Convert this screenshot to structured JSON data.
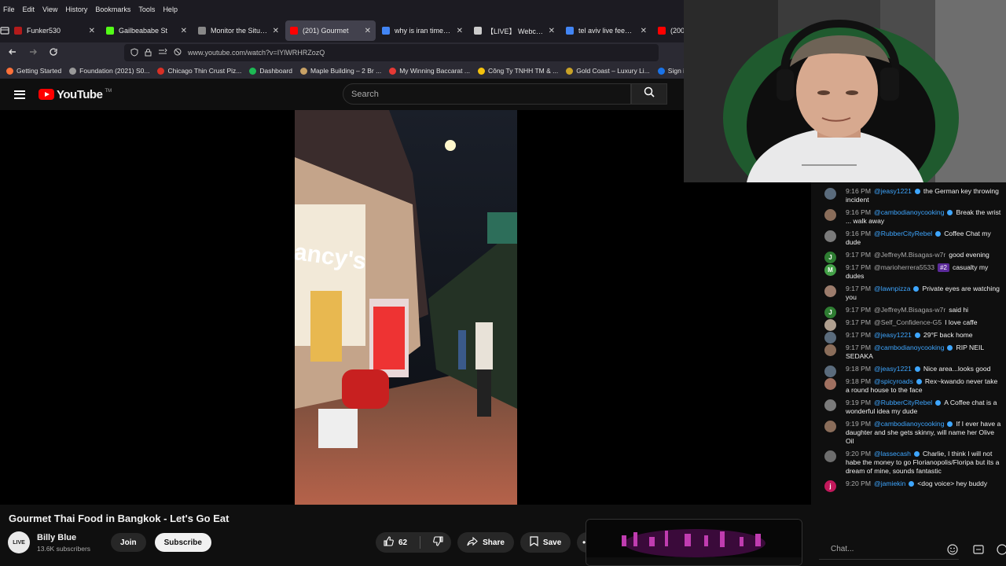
{
  "browser": {
    "menu": [
      "File",
      "Edit",
      "View",
      "History",
      "Bookmarks",
      "Tools",
      "Help"
    ],
    "tabs": [
      {
        "title": "Funker530",
        "color": "#b31b1b",
        "active": false
      },
      {
        "title": "Gailbeababe St",
        "color": "#53fc18",
        "active": false
      },
      {
        "title": "Monitor the Situatio",
        "color": "#888888",
        "active": false
      },
      {
        "title": "(201) Gourmet",
        "color": "#ff0000",
        "active": true
      },
      {
        "title": "why is iran time 30",
        "color": "#4285f4",
        "active": false
      },
      {
        "title": "【LIVE】 Webcam V",
        "color": "#cccccc",
        "active": false
      },
      {
        "title": "tel aviv live feed car",
        "color": "#4285f4",
        "active": false
      },
      {
        "title": "(200",
        "color": "#ff0000",
        "active": false
      }
    ],
    "url": "www.youtube.com/watch?v=IYlWRHRZozQ",
    "bookmarks": [
      {
        "label": "Getting Started",
        "color": "#ff7139"
      },
      {
        "label": "Foundation (2021) S0...",
        "color": "#999999"
      },
      {
        "label": "Chicago Thin Crust Piz...",
        "color": "#d93025"
      },
      {
        "label": "Dashboard",
        "color": "#1db954"
      },
      {
        "label": "Maple Building – 2 Br ...",
        "color": "#c8a165"
      },
      {
        "label": "My Winning Baccarat ...",
        "color": "#e53935"
      },
      {
        "label": "Công Ty TNHH TM & ...",
        "color": "#f4c20d"
      },
      {
        "label": "Gold Coast – Luxury Li...",
        "color": "#c9a227"
      },
      {
        "label": "Sign in - Dream",
        "color": "#1a73e8"
      }
    ]
  },
  "youtube": {
    "logo_text": "YouTube",
    "logo_tm": "TM",
    "search_placeholder": "Search",
    "video_title": "Gourmet Thai Food in Bangkok - Let's Go Eat",
    "channel": {
      "name": "Billy Blue",
      "subscribers": "13.6K subscribers",
      "avatar_text": "LIVE"
    },
    "join_label": "Join",
    "subscribe_label": "Subscribe",
    "like_count": "62",
    "share_label": "Share",
    "save_label": "Save",
    "video_sign_text": "ancy's"
  },
  "chat": {
    "placeholder": "Chat...",
    "messages": [
      {
        "time": "9:16 PM",
        "author": "@jeasy1221",
        "member": true,
        "text": "the German key throwing incident",
        "avatar_color": "#5a6b7c",
        "initial": ""
      },
      {
        "time": "9:16 PM",
        "author": "@cambodianoycooking",
        "member": true,
        "text": "Break the wrist ... walk away",
        "avatar_color": "#8a6d5a",
        "initial": ""
      },
      {
        "time": "9:16 PM",
        "author": "@RubberCityRebel",
        "member": true,
        "text": "Coffee Chat my dude",
        "avatar_color": "#7a7a7a",
        "initial": ""
      },
      {
        "time": "9:17 PM",
        "author": "@JeffreyM.Bisagas-w7r",
        "member": false,
        "text": "good evening",
        "avatar_color": "#2e7d32",
        "initial": "J"
      },
      {
        "time": "9:17 PM",
        "author": "@marioherrera5533",
        "member": false,
        "badge": "#2",
        "text": "casualty my dudes",
        "avatar_color": "#43a047",
        "initial": "M"
      },
      {
        "time": "9:17 PM",
        "author": "@lawnpizza",
        "member": true,
        "text": "Private eyes are watching you",
        "avatar_color": "#9c7c6c",
        "initial": ""
      },
      {
        "time": "9:17 PM",
        "author": "@JeffreyM.Bisagas-w7r",
        "member": false,
        "text": "said hi",
        "avatar_color": "#2e7d32",
        "initial": "J"
      },
      {
        "time": "9:17 PM",
        "author": "@Self_Confidence-G5",
        "member": false,
        "text": "I love caffe",
        "avatar_color": "#b0a090",
        "initial": ""
      },
      {
        "time": "9:17 PM",
        "author": "@jeasy1221",
        "member": true,
        "text": "29°F back home",
        "avatar_color": "#5a6b7c",
        "initial": ""
      },
      {
        "time": "9:17 PM",
        "author": "@cambodianoycooking",
        "member": true,
        "text": "RIP NEIL SEDAKA",
        "avatar_color": "#8a6d5a",
        "initial": ""
      },
      {
        "time": "9:18 PM",
        "author": "@jeasy1221",
        "member": true,
        "text": "Nice area...looks good",
        "avatar_color": "#5a6b7c",
        "initial": ""
      },
      {
        "time": "9:18 PM",
        "author": "@spicyroads",
        "member": true,
        "text": "Rex~kwando never take a round house to the face",
        "avatar_color": "#a07060",
        "initial": ""
      },
      {
        "time": "9:19 PM",
        "author": "@RubberCityRebel",
        "member": true,
        "text": "A Coffee chat is a wonderful idea my dude",
        "avatar_color": "#7a7a7a",
        "initial": ""
      },
      {
        "time": "9:19 PM",
        "author": "@cambodianoycooking",
        "member": true,
        "text": "If I ever have a daughter and she gets skinny, will name her Olive Oil",
        "avatar_color": "#8a6d5a",
        "initial": ""
      },
      {
        "time": "9:20 PM",
        "author": "@lassecash",
        "member": true,
        "text": "Charlie, I think I will not habe the money to go Florianopolis/Floripa but its a dream of mine, sounds fantastic",
        "avatar_color": "#6d6d6d",
        "initial": ""
      },
      {
        "time": "9:20 PM",
        "author": "@jamiekin",
        "member": true,
        "text": "<dog voice> hey buddy",
        "avatar_color": "#c2185b",
        "initial": "j"
      }
    ]
  }
}
